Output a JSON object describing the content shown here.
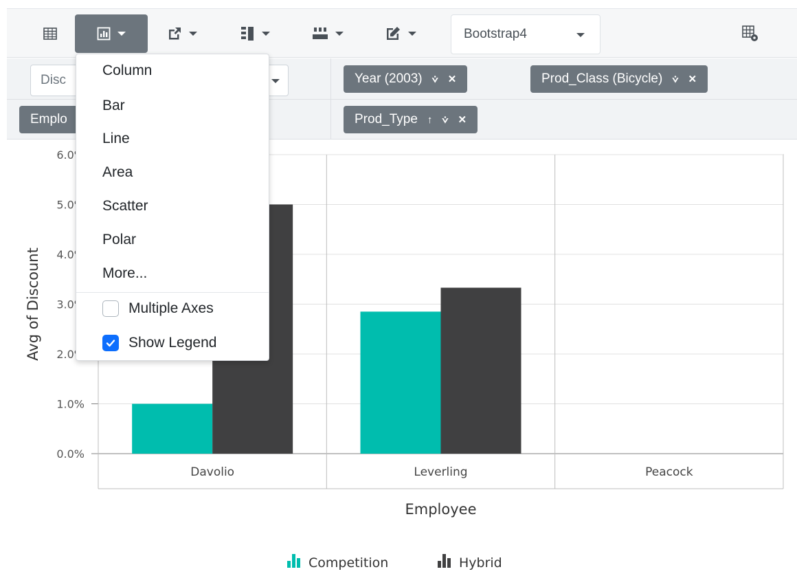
{
  "toolbar": {
    "items": [
      {
        "name": "grid-view",
        "icon": "grid-icon"
      },
      {
        "name": "chart-view",
        "icon": "chart-icon",
        "active": true
      },
      {
        "name": "export",
        "icon": "export-icon"
      },
      {
        "name": "subtotals",
        "icon": "subtotal-icon"
      },
      {
        "name": "grand-totals",
        "icon": "grand-total-icon"
      },
      {
        "name": "conditional-format",
        "icon": "edit-format-icon"
      }
    ],
    "theme_select": {
      "value": "Bootstrap4"
    },
    "field_list_icon": "field-list-icon"
  },
  "grouping_bar": {
    "values_dropdown": {
      "value": "Disc"
    },
    "rows_pill": {
      "label": "Emplo"
    },
    "filters": [
      {
        "label": "Year (2003)"
      },
      {
        "label": "Prod_Class (Bicycle)"
      }
    ],
    "columns": [
      {
        "label": "Prod_Type"
      }
    ]
  },
  "chart_menu": {
    "items": [
      "Column",
      "Bar",
      "Line",
      "Area",
      "Scatter",
      "Polar",
      "More..."
    ],
    "multiple_axes": {
      "label": "Multiple Axes",
      "checked": false
    },
    "show_legend": {
      "label": "Show Legend",
      "checked": true
    }
  },
  "chart_data": {
    "type": "bar",
    "categories": [
      "Davolio",
      "Leverling",
      "Peacock"
    ],
    "series": [
      {
        "name": "Competition",
        "values": [
          1.0,
          2.85,
          null
        ],
        "color": "#00bdae"
      },
      {
        "name": "Hybrid",
        "values": [
          5.0,
          3.33,
          null
        ],
        "color": "#404041"
      }
    ],
    "xlabel": "Employee",
    "ylabel": "Avg of Discount",
    "ylim": [
      0,
      6
    ],
    "yticks": [
      "0.0%",
      "1.0%",
      "2.0%",
      "3.0%",
      "4.0%",
      "5.0%",
      "6.0%"
    ],
    "grid": true,
    "legend": "bottom"
  }
}
